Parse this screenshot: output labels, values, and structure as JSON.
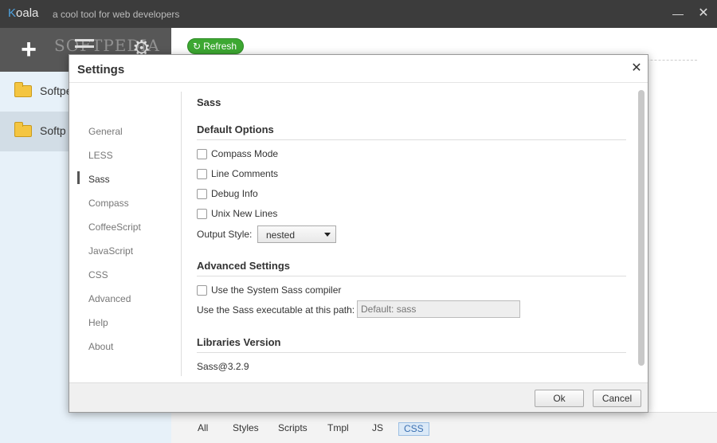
{
  "app": {
    "name_first": "K",
    "name_rest": "oala",
    "tagline": "a cool tool for web developers",
    "minimize_glyph": "—",
    "close_glyph": "✕"
  },
  "sidebar": {
    "add_glyph": "+",
    "gear_glyph": "⚙",
    "watermark": "SOFTPEDIA",
    "projects": [
      {
        "label": "Softpe"
      },
      {
        "label": "Softp"
      }
    ]
  },
  "main": {
    "refresh_icon": "↻",
    "refresh_label": "Refresh",
    "filters": [
      "All",
      "Styles",
      "Scripts",
      "Tmpl",
      "JS",
      "CSS"
    ],
    "active_filter": "CSS"
  },
  "dialog": {
    "title": "Settings",
    "close_glyph": "✕",
    "nav": [
      "General",
      "LESS",
      "Sass",
      "Compass",
      "CoffeeScript",
      "JavaScript",
      "CSS",
      "Advanced",
      "Help",
      "About"
    ],
    "active_nav": "Sass",
    "section_title": "Sass",
    "default_options": {
      "heading": "Default Options",
      "checks": [
        {
          "label": "Compass Mode",
          "checked": false
        },
        {
          "label": "Line Comments",
          "checked": false
        },
        {
          "label": "Debug Info",
          "checked": false
        },
        {
          "label": "Unix New Lines",
          "checked": false
        }
      ],
      "output_style_label": "Output Style:",
      "output_style_value": "nested"
    },
    "advanced_settings": {
      "heading": "Advanced Settings",
      "system_compiler_label": "Use the System Sass compiler",
      "system_compiler_checked": false,
      "path_label": "Use the Sass executable at this path:",
      "path_placeholder": "Default: sass"
    },
    "libraries": {
      "heading": "Libraries Version",
      "value": "Sass@3.2.9"
    },
    "ok_label": "Ok",
    "cancel_label": "Cancel"
  }
}
